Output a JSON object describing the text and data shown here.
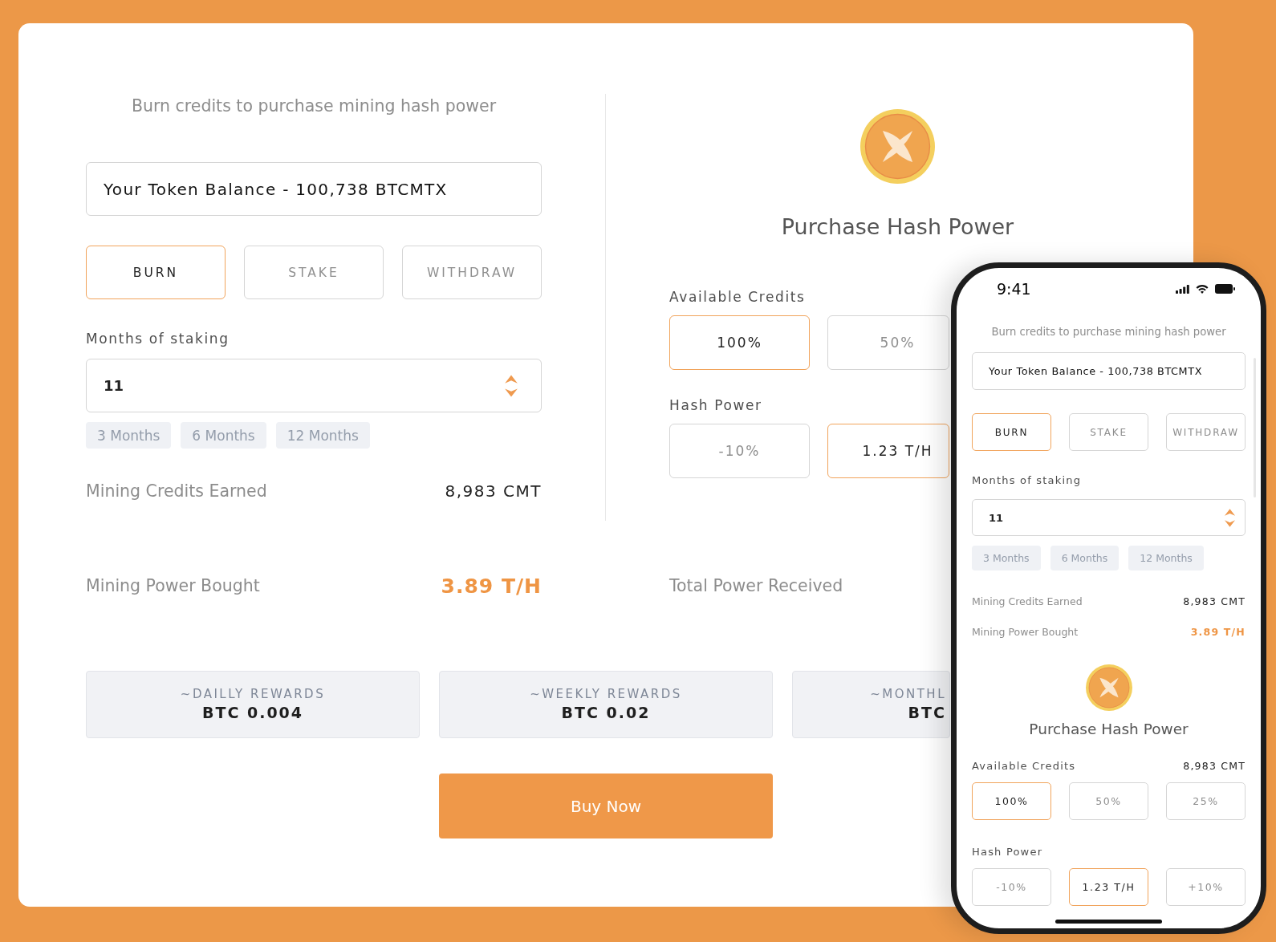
{
  "purchase_form": {
    "subtitle": "Burn credits to purchase mining hash power",
    "balance": "Your Token Balance - 100,738 BTCMTX",
    "modes": [
      {
        "label": "BURN",
        "selected": true
      },
      {
        "label": "STAKE",
        "selected": false
      },
      {
        "label": "WITHDRAW",
        "selected": false
      }
    ],
    "months": {
      "label": "Months of staking",
      "value": "11",
      "presets": [
        "3 Months",
        "6 Months",
        "12 Months"
      ]
    },
    "credits_earned": {
      "label": "Mining Credits Earned",
      "value": "8,983 CMT"
    }
  },
  "hash_power": {
    "title": "Purchase Hash Power",
    "credits": {
      "label": "Available Credits",
      "options": [
        {
          "label": "100%",
          "selected": true
        },
        {
          "label": "50%",
          "selected": false
        }
      ]
    },
    "power": {
      "label": "Hash Power",
      "options": [
        {
          "label": "-10%",
          "selected": false
        },
        {
          "label": "1.23 T/H",
          "selected": true
        }
      ]
    }
  },
  "power_bought": {
    "label": "Mining Power Bought",
    "value": "3.89 T/H"
  },
  "total_power": {
    "label": "Total Power Received"
  },
  "rewards": [
    {
      "label": "~DAILLY REWARDS",
      "value": "BTC 0.004"
    },
    {
      "label": "~WEEKLY REWARDS",
      "value": "BTC 0.02"
    },
    {
      "label": "~MONTHL",
      "value": "BTC"
    }
  ],
  "buy_button": "Buy Now",
  "phone": {
    "status_bar": {
      "time": "9:41"
    },
    "subtitle": "Burn credits to purchase mining hash power",
    "balance": "Your Token Balance - 100,738 BTCMTX",
    "modes": [
      {
        "label": "BURN",
        "selected": true
      },
      {
        "label": "STAKE",
        "selected": false
      },
      {
        "label": "WITHDRAW",
        "selected": false
      }
    ],
    "months": {
      "label": "Months of staking",
      "value": "11",
      "presets": [
        "3 Months",
        "6 Months",
        "12 Months"
      ]
    },
    "credits_earned": {
      "label": "Mining Credits Earned",
      "value": "8,983 CMT"
    },
    "power_bought": {
      "label": "Mining Power Bought",
      "value": "3.89 T/H"
    },
    "hash_power": {
      "title": "Purchase Hash Power",
      "credits": {
        "label": "Available Credits",
        "value": "8,983 CMT",
        "options": [
          {
            "label": "100%",
            "selected": true
          },
          {
            "label": "50%",
            "selected": false
          },
          {
            "label": "25%",
            "selected": false
          }
        ]
      },
      "power": {
        "label": "Hash Power",
        "options": [
          {
            "label": "-10%",
            "selected": false
          },
          {
            "label": "1.23 T/H",
            "selected": true
          },
          {
            "label": "+10%",
            "selected": false
          }
        ]
      }
    }
  }
}
